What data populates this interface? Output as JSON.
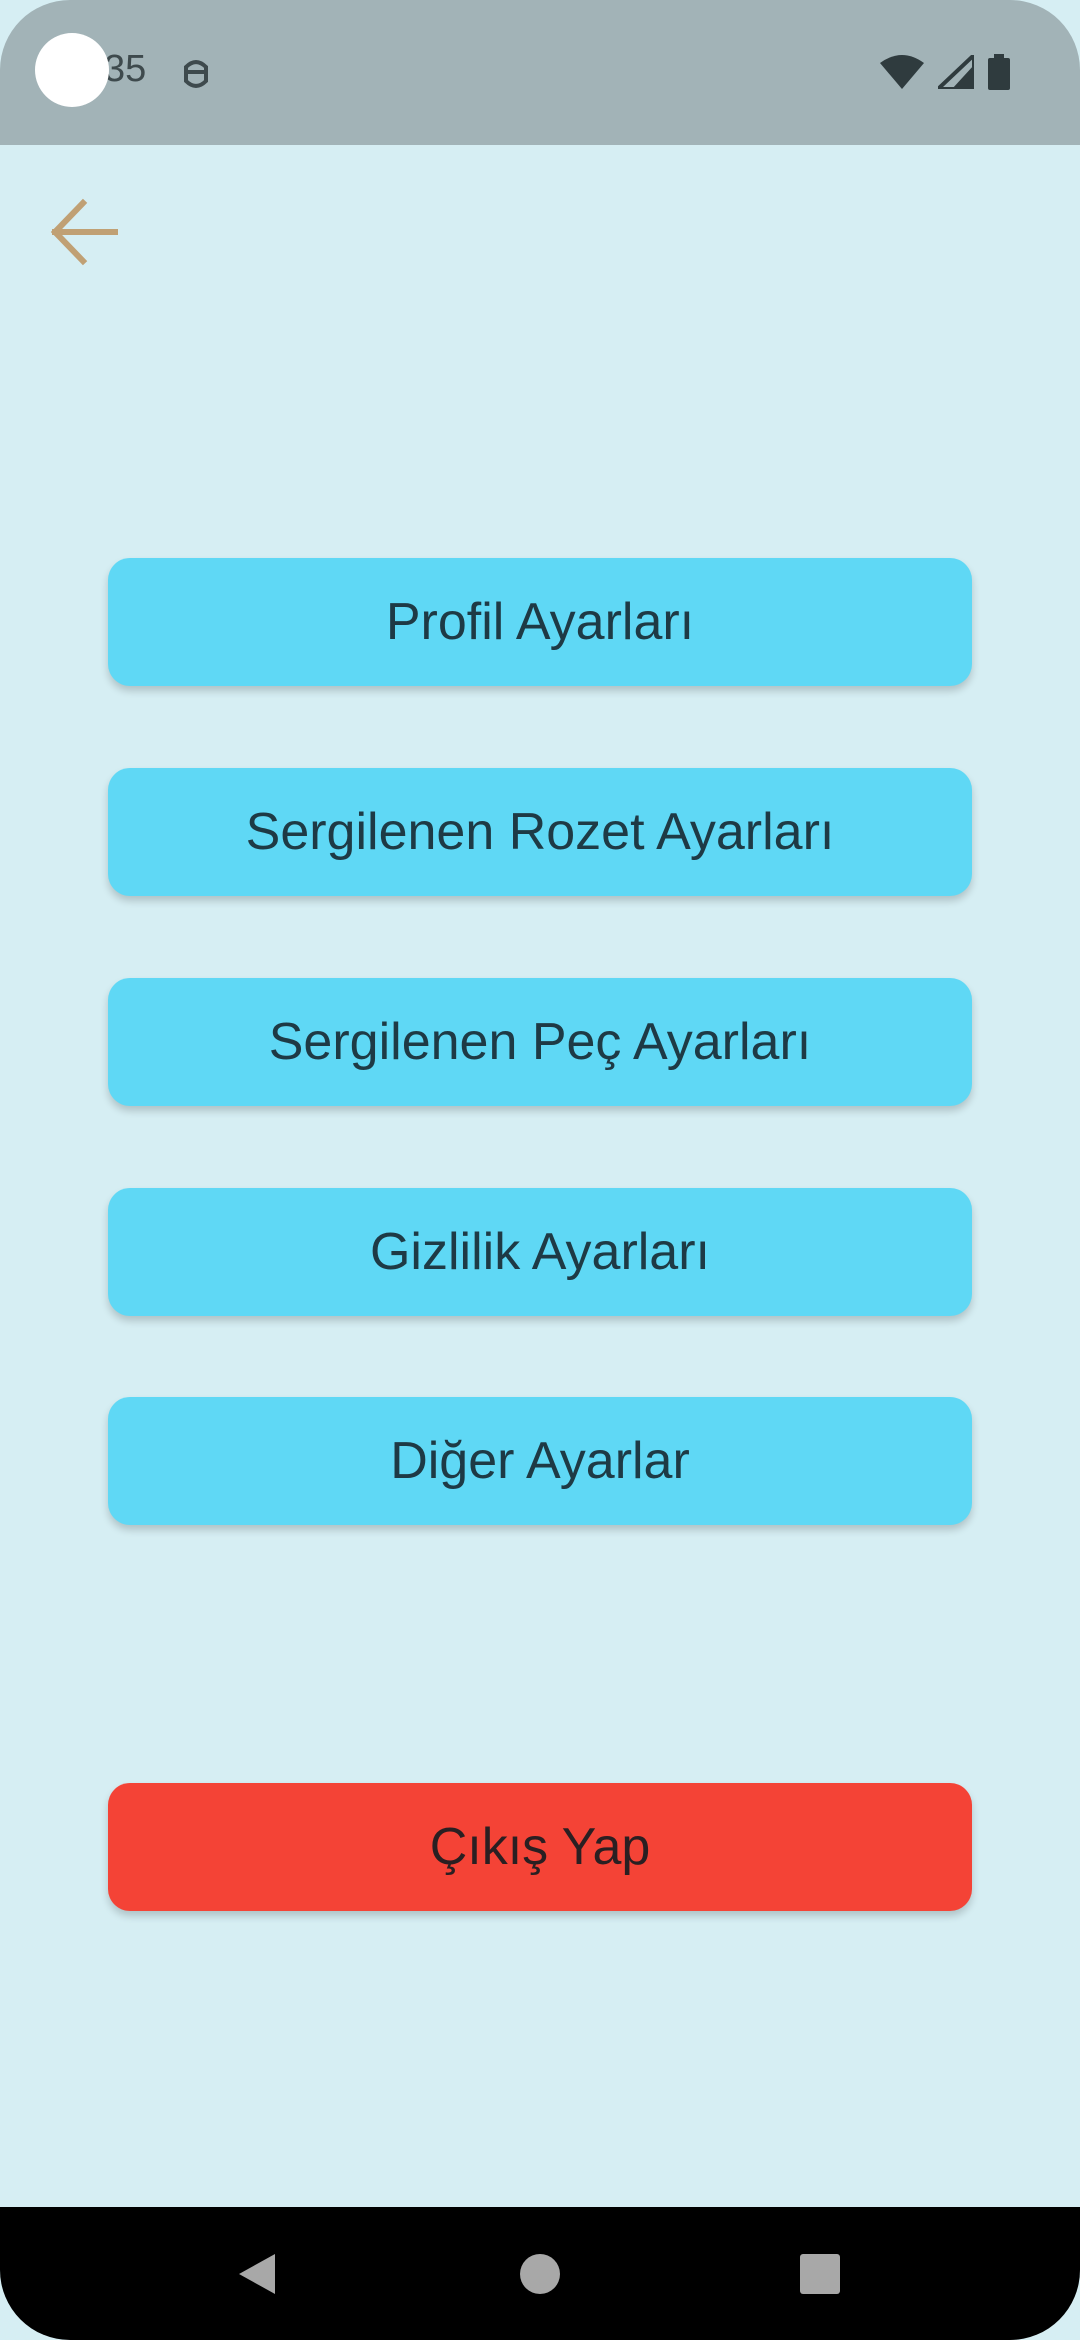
{
  "status_bar": {
    "time": "35",
    "notification_icon": "privacy-face-icon",
    "icons": [
      "wifi-icon",
      "signal-icon",
      "battery-icon"
    ]
  },
  "header": {
    "back_icon": "arrow-left-icon",
    "back_color": "#c0a074"
  },
  "menu": {
    "items": [
      {
        "label": "Profil Ayarları"
      },
      {
        "label": "Sergilenen Rozet Ayarları"
      },
      {
        "label": "Sergilenen Peç Ayarları"
      },
      {
        "label": "Gizlilik Ayarları"
      },
      {
        "label": "Diğer Ayarlar"
      }
    ],
    "logout_label": "Çıkış Yap"
  },
  "colors": {
    "background": "#d6eef3",
    "status_bar": "#a2b3b7",
    "button": "#5fd8f5",
    "logout": "#f44336",
    "text": "#1e3a45"
  },
  "nav_bar": {
    "icons": [
      "back-triangle-icon",
      "home-circle-icon",
      "recents-square-icon"
    ]
  }
}
